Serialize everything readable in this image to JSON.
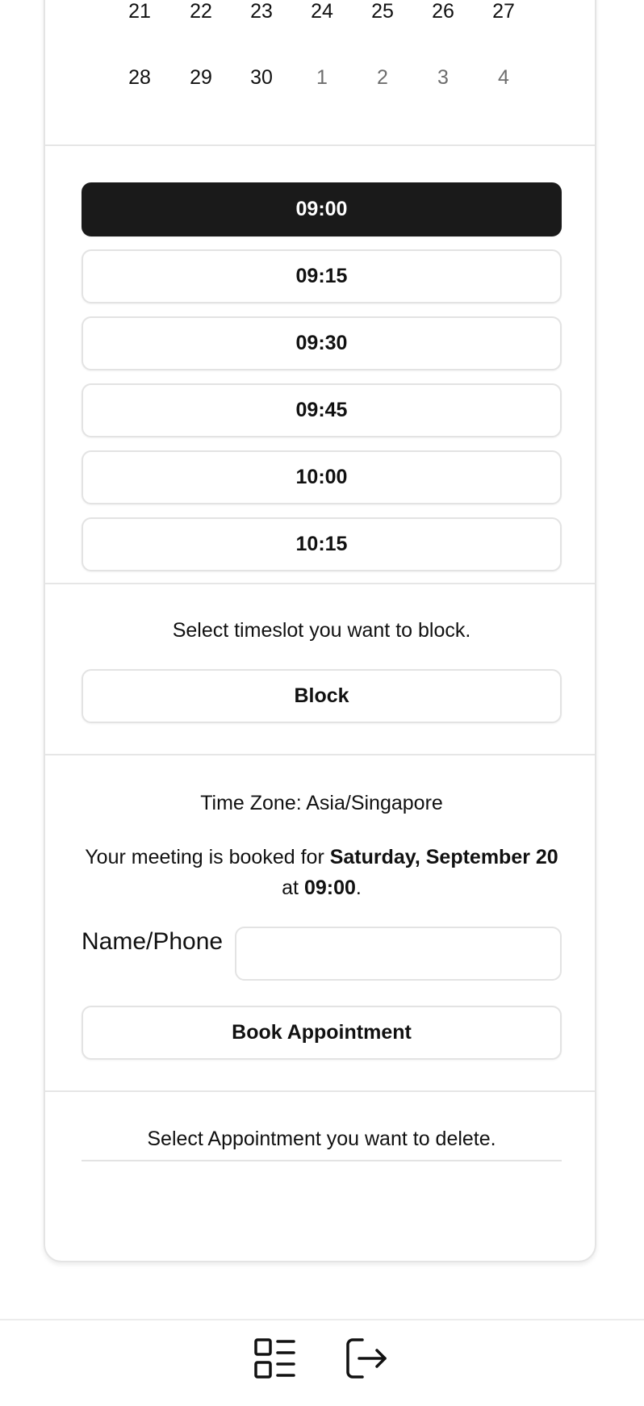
{
  "calendar": {
    "rows": [
      [
        {
          "label": "21",
          "muted": false
        },
        {
          "label": "22",
          "muted": false
        },
        {
          "label": "23",
          "muted": false
        },
        {
          "label": "24",
          "muted": false
        },
        {
          "label": "25",
          "muted": false
        },
        {
          "label": "26",
          "muted": false
        },
        {
          "label": "27",
          "muted": false
        }
      ],
      [
        {
          "label": "28",
          "muted": false
        },
        {
          "label": "29",
          "muted": false
        },
        {
          "label": "30",
          "muted": false
        },
        {
          "label": "1",
          "muted": true
        },
        {
          "label": "2",
          "muted": true
        },
        {
          "label": "3",
          "muted": true
        },
        {
          "label": "4",
          "muted": true
        }
      ]
    ]
  },
  "timeslots": {
    "selected_index": 0,
    "items": [
      "09:00",
      "09:15",
      "09:30",
      "09:45",
      "10:00",
      "10:15"
    ]
  },
  "block": {
    "instruction": "Select timeslot you want to block.",
    "button_label": "Block"
  },
  "booking": {
    "timezone_text": "Time Zone: Asia/Singapore",
    "summary_prefix": "Your meeting is booked for ",
    "summary_date": "Saturday, September 20",
    "summary_mid": " at ",
    "summary_time": "09:00",
    "summary_suffix": ".",
    "name_label": "Name/Phone",
    "name_value": "",
    "name_placeholder": "",
    "book_button_label": "Book Appointment"
  },
  "delete": {
    "instruction": "Select Appointment you want to delete."
  },
  "bottom_nav": {
    "items": [
      {
        "icon": "list-icon"
      },
      {
        "icon": "logout-icon"
      }
    ]
  },
  "colors": {
    "selected_slot_bg": "#1a1a1a",
    "border": "#e3e3e3",
    "muted_date": "#6e6e6e"
  }
}
